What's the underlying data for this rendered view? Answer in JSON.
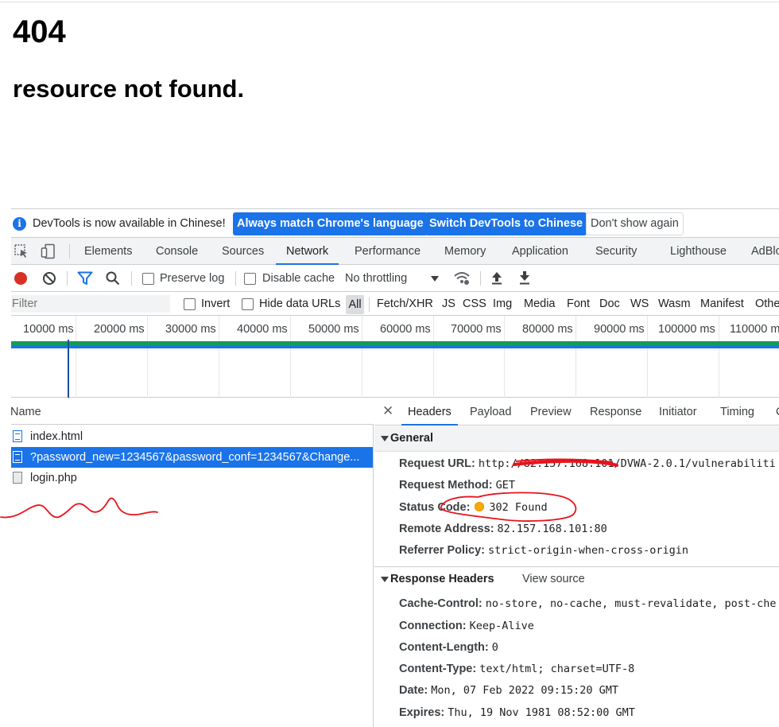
{
  "page": {
    "code": "404",
    "message": "resource not found."
  },
  "infobar": {
    "text": "DevTools is now available in Chinese!",
    "btn_match": "Always match Chrome's language",
    "btn_switch": "Switch DevTools to Chinese",
    "btn_dismiss": "Don't show again"
  },
  "tabs": [
    "Elements",
    "Console",
    "Sources",
    "Network",
    "Performance",
    "Memory",
    "Application",
    "Security",
    "Lighthouse",
    "AdBlo"
  ],
  "toolbar": {
    "preserve_log": "Preserve log",
    "disable_cache": "Disable cache",
    "throttling": "No throttling"
  },
  "filterbar": {
    "placeholder": "Filter",
    "invert": "Invert",
    "hide_data_urls": "Hide data URLs",
    "types": [
      "All",
      "Fetch/XHR",
      "JS",
      "CSS",
      "Img",
      "Media",
      "Font",
      "Doc",
      "WS",
      "Wasm",
      "Manifest",
      "Othe"
    ]
  },
  "timeline": {
    "ticks": [
      "10000 ms",
      "20000 ms",
      "30000 ms",
      "40000 ms",
      "50000 ms",
      "60000 ms",
      "70000 ms",
      "80000 ms",
      "90000 ms",
      "100000 ms",
      "110000 m"
    ]
  },
  "requests": {
    "header": "Name",
    "rows": [
      "index.html",
      "?password_new=1234567&password_conf=1234567&Change...",
      "login.php"
    ]
  },
  "details": {
    "tabs": [
      "Headers",
      "Payload",
      "Preview",
      "Response",
      "Initiator",
      "Timing",
      "C"
    ],
    "general": {
      "title": "General",
      "request_url_key": "Request URL:",
      "request_url_val": "http://82.157.168.101/DVWA-2.0.1/vulnerabiliti",
      "request_method_key": "Request Method:",
      "request_method_val": "GET",
      "status_code_key": "Status Code:",
      "status_code_val": "302 Found",
      "remote_address_key": "Remote Address:",
      "remote_address_val": "82.157.168.101:80",
      "referrer_policy_key": "Referrer Policy:",
      "referrer_policy_val": "strict-origin-when-cross-origin"
    },
    "response_headers": {
      "title": "Response Headers",
      "view_source": "View source",
      "items": [
        {
          "k": "Cache-Control:",
          "v": "no-store, no-cache, must-revalidate, post-che"
        },
        {
          "k": "Connection:",
          "v": "Keep-Alive"
        },
        {
          "k": "Content-Length:",
          "v": "0"
        },
        {
          "k": "Content-Type:",
          "v": "text/html; charset=UTF-8"
        },
        {
          "k": "Date:",
          "v": "Mon, 07 Feb 2022 09:15:20 GMT"
        },
        {
          "k": "Expires:",
          "v": "Thu, 19 Nov 1981 08:52:00 GMT"
        }
      ]
    }
  },
  "colors": {
    "accent": "#1a73e8",
    "record": "#d93025",
    "status_warning": "#f9ab00",
    "annotation": "#e8131b"
  }
}
